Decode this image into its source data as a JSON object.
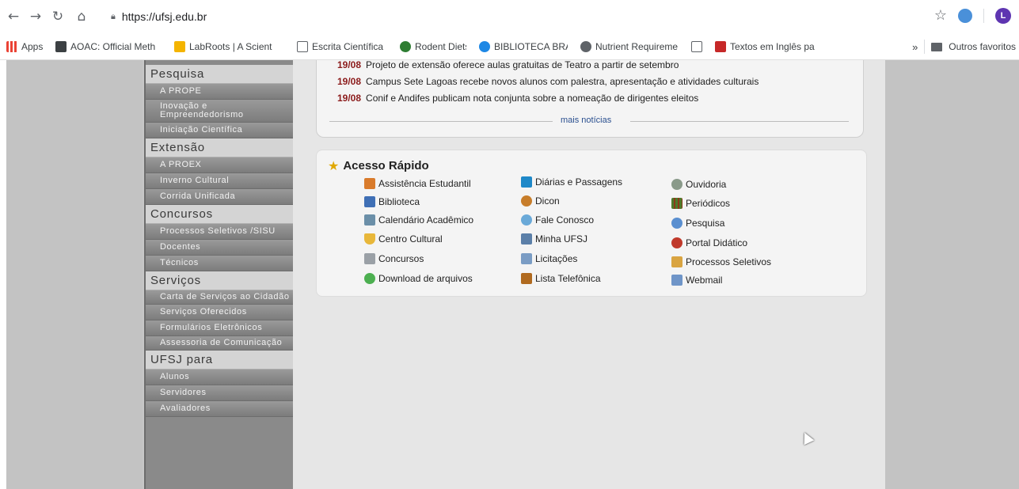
{
  "browser": {
    "url": "https://ufsj.edu.br",
    "profile_initial": "L",
    "bookmarks": [
      {
        "label": "Apps",
        "color": "#ea4335"
      },
      {
        "label": "AOAC: Official Meth",
        "color": "#3c4043"
      },
      {
        "label": "LabRoots | A Scient",
        "color": "#f4b400"
      },
      {
        "label": "Escrita Científica",
        "color": "#ffffff"
      },
      {
        "label": "Rodent Diets",
        "color": "#2e7d32"
      },
      {
        "label": "BIBLIOTECA BRASIL",
        "color": "#1e88e5"
      },
      {
        "label": "Nutrient Requireme",
        "color": "#5f6368"
      },
      {
        "label": "",
        "color": "#ffffff"
      },
      {
        "label": "Textos em Inglês pa",
        "color": "#c62828"
      }
    ],
    "more_label": "»",
    "other_bookmarks": "Outros favoritos"
  },
  "sidebar": {
    "sections": [
      {
        "title": "Pesquisa",
        "items": [
          "A PROPE",
          "Inovação e Empreendedorismo",
          "Iniciação Científica"
        ]
      },
      {
        "title": "Extensão",
        "items": [
          "A PROEX",
          "Inverno Cultural",
          "Corrida Unificada"
        ]
      },
      {
        "title": "Concursos",
        "items": [
          "Processos Seletivos /SISU",
          "Docentes",
          "Técnicos"
        ]
      },
      {
        "title": "Serviços",
        "items": [
          "Carta de Serviços ao Cidadão",
          "Serviços Oferecidos",
          "Formulários Eletrônicos",
          "Assessoria de Comunicação"
        ]
      },
      {
        "title": "UFSJ para",
        "items": [
          "Alunos",
          "Servidores",
          "Avaliadores"
        ]
      }
    ]
  },
  "news": {
    "items": [
      {
        "date": "19/08",
        "text": "Projeto de extensão oferece aulas gratuitas de Teatro a partir de setembro"
      },
      {
        "date": "19/08",
        "text": "Campus Sete Lagoas recebe novos alunos com palestra, apresentação e atividades culturais"
      },
      {
        "date": "19/08",
        "text": "Conif e Andifes publicam nota conjunta sobre a nomeação de dirigentes eleitos"
      }
    ],
    "more_label": "mais notícias"
  },
  "quick_access": {
    "title": "Acesso Rápido",
    "links": [
      {
        "label": "Assistência Estudantil",
        "icon": "people-icon",
        "color": "#d97b2b"
      },
      {
        "label": "Biblioteca",
        "icon": "book-icon",
        "color": "#3f6fb5"
      },
      {
        "label": "Calendário Acadêmico",
        "icon": "calendar-icon",
        "color": "#6b8fa8"
      },
      {
        "label": "Centro Cultural",
        "icon": "shield-icon",
        "color": "#e8b73a"
      },
      {
        "label": "Concursos",
        "icon": "trophy-icon",
        "color": "#9aa0a6"
      },
      {
        "label": "Download de arquivos",
        "icon": "download-icon",
        "color": "#4caf50"
      },
      {
        "label": "Diárias e Passagens",
        "icon": "plane-icon",
        "color": "#1e88c8"
      },
      {
        "label": "Dicon",
        "icon": "users-icon",
        "color": "#c77d2a"
      },
      {
        "label": "Fale Conosco",
        "icon": "chat-icon",
        "color": "#6aa9d8"
      },
      {
        "label": "Minha UFSJ",
        "icon": "monitor-icon",
        "color": "#5b7fa8"
      },
      {
        "label": "Licitações",
        "icon": "document-icon",
        "color": "#7a9cc4"
      },
      {
        "label": "Lista Telefônica",
        "icon": "phonebook-icon",
        "color": "#b06a1f"
      },
      {
        "label": "Ouvidoria",
        "icon": "ear-icon",
        "color": "#8a9a8a"
      },
      {
        "label": "Periódicos",
        "icon": "books-icon",
        "color": "#4f7a2a"
      },
      {
        "label": "Pesquisa",
        "icon": "magnifier-icon",
        "color": "#5a8fd0"
      },
      {
        "label": "Portal Didático",
        "icon": "portal-icon",
        "color": "#c0392b"
      },
      {
        "label": "Processos Seletivos",
        "icon": "form-icon",
        "color": "#d9a441"
      },
      {
        "label": "Webmail",
        "icon": "mail-icon",
        "color": "#6f95c8"
      }
    ]
  }
}
